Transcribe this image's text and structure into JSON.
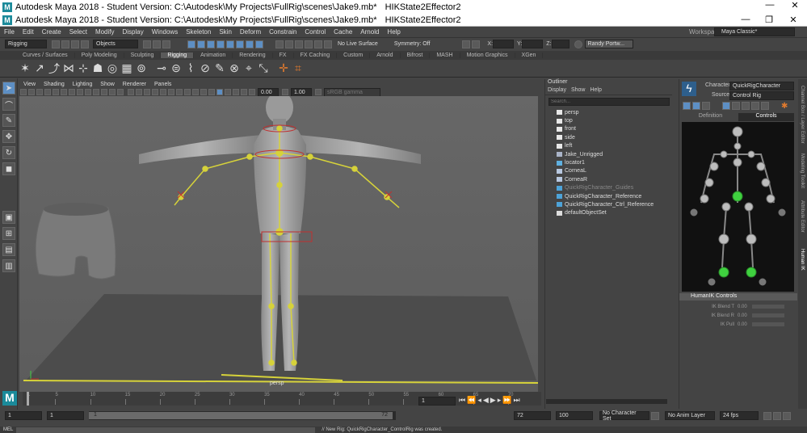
{
  "window": {
    "title1": "Autodesk Maya 2018 - Student Version: C:\\Autodesk\\My Projects\\FullRig\\scenes\\Jake9.mb*",
    "title2": "Autodesk Maya 2018 - Student Version: C:\\Autodesk\\My Projects\\FullRig\\scenes\\Jake9.mb*",
    "subtitle1": "HIKState2Effector2",
    "subtitle2": "HIKState2Effector2",
    "minimize": "—",
    "maximize": "☐",
    "restore": "❐",
    "close": "✕"
  },
  "menubar": [
    "File",
    "Edit",
    "Create",
    "Select",
    "Modify",
    "Display",
    "Windows",
    "Skeleton",
    "Skin",
    "Deform",
    "Constrain",
    "Control",
    "Cache",
    "Arnold",
    "Help"
  ],
  "workspace": {
    "label": "Workspace :",
    "value": "Maya Classic*"
  },
  "toolbar": {
    "menuset": "Rigging",
    "objects": "Objects",
    "live_surface": "No Live Surface",
    "symmetry": "Symmetry: Off",
    "x_label": "X:",
    "y_label": "Y:",
    "z_label": "Z:",
    "user": "Randy Portw..."
  },
  "shelf_tabs": [
    "Curves / Surfaces",
    "Poly Modeling",
    "Sculpting",
    "Rigging",
    "Animation",
    "Rendering",
    "FX",
    "FX Caching",
    "Custom",
    "Arnold",
    "Bifrost",
    "MASH",
    "Motion Graphics",
    "XGen"
  ],
  "shelf_active": "Rigging",
  "viewport": {
    "menus": [
      "View",
      "Shading",
      "Lighting",
      "Show",
      "Renderer",
      "Panels"
    ],
    "field1": "0.00",
    "field2": "1.00",
    "colorspace": "sRGB gamma",
    "camera_label": "persp"
  },
  "outliner": {
    "title": "Outliner",
    "menus": [
      "Display",
      "Show",
      "Help"
    ],
    "search_placeholder": "Search...",
    "items": [
      {
        "label": "persp",
        "icon": "camera-icon",
        "dim": false
      },
      {
        "label": "top",
        "icon": "camera-icon",
        "dim": false
      },
      {
        "label": "front",
        "icon": "camera-icon",
        "dim": false
      },
      {
        "label": "side",
        "icon": "camera-icon",
        "dim": false
      },
      {
        "label": "left",
        "icon": "camera-icon",
        "dim": false
      },
      {
        "label": "Jake_Unrigged",
        "icon": "group-icon",
        "dim": false
      },
      {
        "label": "locator1",
        "icon": "locator-icon",
        "dim": false
      },
      {
        "label": "CorneaL",
        "icon": "cornea-icon",
        "dim": false
      },
      {
        "label": "CorneaR",
        "icon": "cornea-icon",
        "dim": false
      },
      {
        "label": "QuickRigCharacter_Guides",
        "icon": "joint-icon",
        "dim": true
      },
      {
        "label": "QuickRigCharacter_Reference",
        "icon": "joint-icon",
        "dim": false
      },
      {
        "label": "QuickRigCharacter_Ctrl_Reference",
        "icon": "joint-icon",
        "dim": false
      },
      {
        "label": "defaultObjectSet",
        "icon": "set-icon",
        "dim": false
      }
    ]
  },
  "humanik": {
    "character_label": "Character:",
    "character_value": "QuickRigCharacter",
    "source_label": "Source:",
    "source_value": "Control Rig",
    "tabs": [
      "Definition",
      "Controls"
    ],
    "active_tab": "Controls",
    "controls_header": "HumanIK Controls",
    "sliders": [
      {
        "label": "IK Blend T",
        "value": "0.00"
      },
      {
        "label": "IK Blend R",
        "value": "0.00"
      },
      {
        "label": "IK Pull",
        "value": "0.00"
      }
    ]
  },
  "side_tabs": [
    "Channel Box / Layer Editor",
    "Modeling Toolkit",
    "Attribute Editor",
    "Human IK"
  ],
  "timeline": {
    "ticks": [
      "1",
      "5",
      "10",
      "15",
      "20",
      "25",
      "30",
      "35",
      "40",
      "45",
      "50",
      "55",
      "60",
      "65",
      "70"
    ],
    "current_frame": "1"
  },
  "range": {
    "start": "1",
    "inner_start": "1",
    "slider_start": "1",
    "slider_end": "72",
    "end": "72",
    "anim_end": "100",
    "character_set": "No Character Set",
    "anim_layer": "No Anim Layer",
    "fps": "24 fps"
  },
  "cmdline": {
    "label": "MEL",
    "message": "// New Rig: QuickRigCharacter_ControlRig was created."
  },
  "colors": {
    "rig_yellow": "#d6d23a",
    "control_red": "#c03030",
    "hik_green": "#3fd13f",
    "selected_blue": "#5d8fc4"
  }
}
